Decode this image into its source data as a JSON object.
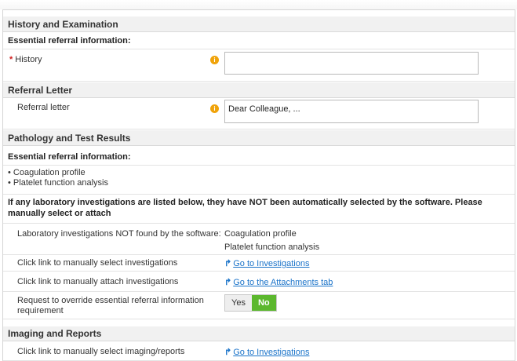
{
  "history_section": {
    "title": "History and Examination",
    "essential_heading": "Essential referral information:",
    "required_marker": "*",
    "history_label": "History",
    "history_value": ""
  },
  "referral_section": {
    "title": "Referral Letter",
    "letter_label": "Referral letter",
    "letter_value": "Dear Colleague, ..."
  },
  "pathology_section": {
    "title": "Pathology and Test Results",
    "essential_heading": "Essential referral information:",
    "essential_items": [
      "Coagulation profile",
      "Platelet function analysis"
    ],
    "notice": "If any laboratory investigations are listed below, they have NOT been automatically selected by the software. Please manually select or attach",
    "not_found_label": "Laboratory investigations NOT found by the software:",
    "not_found_items": [
      "Coagulation profile",
      "Platelet function analysis"
    ],
    "select_label": "Click link to manually select investigations",
    "select_link": "Go to Investigations",
    "attach_label": "Click link to manually attach investigations",
    "attach_link": "Go to the Attachments tab",
    "override_label": "Request to override essential referral information requirement",
    "override_yes": "Yes",
    "override_no": "No",
    "override_selected": "No"
  },
  "imaging_section": {
    "title": "Imaging and Reports",
    "select_label": "Click link to manually select imaging/reports",
    "select_link": "Go to Investigations"
  },
  "icons": {
    "info": "info-icon",
    "link_arrow": "redirect-arrow-icon"
  },
  "colors": {
    "required": "#d02020",
    "info": "#f0a30a",
    "link": "#1a73c9",
    "toggle_active": "#5cb82e",
    "section_bg": "#f1f1f1"
  }
}
